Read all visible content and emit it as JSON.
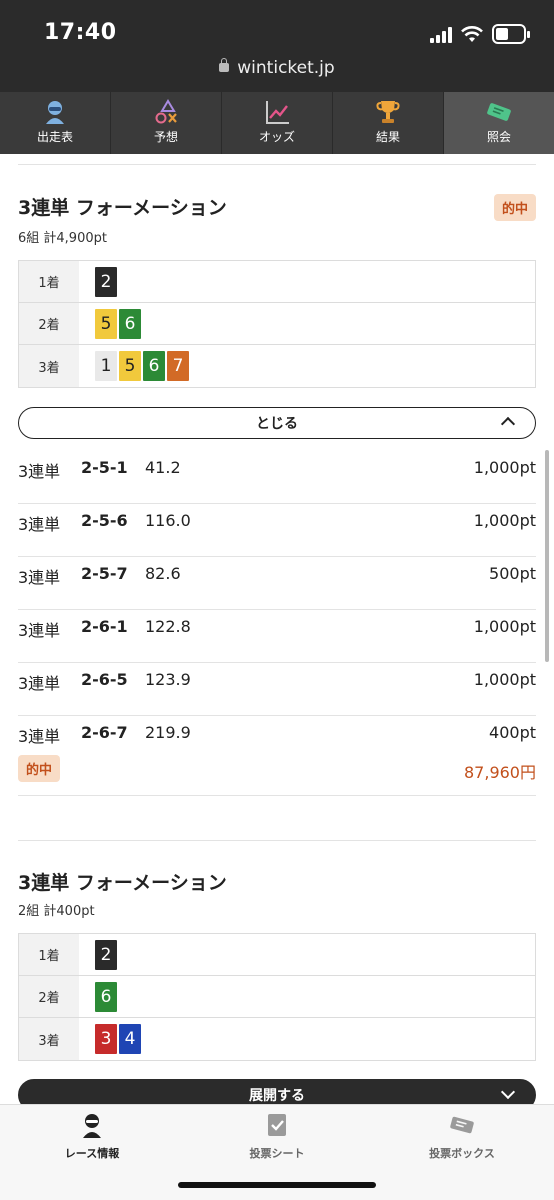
{
  "status": {
    "time": "17:40",
    "url": "winticket.jp"
  },
  "nav": {
    "tabs": [
      {
        "label": "出走表",
        "icon": "rider-icon"
      },
      {
        "label": "予想",
        "icon": "prediction-icon"
      },
      {
        "label": "オッズ",
        "icon": "odds-chart-icon"
      },
      {
        "label": "結果",
        "icon": "trophy-icon"
      },
      {
        "label": "照会",
        "icon": "ticket-icon"
      }
    ],
    "active_index": 4
  },
  "bet1": {
    "title": "3連単 フォーメーション",
    "summary": "6組 計4,900pt",
    "hit_label": "的中",
    "positions": [
      {
        "label": "1着",
        "numbers": [
          "2"
        ]
      },
      {
        "label": "2着",
        "numbers": [
          "5",
          "6"
        ]
      },
      {
        "label": "3着",
        "numbers": [
          "1",
          "5",
          "6",
          "7"
        ]
      }
    ],
    "toggle_label": "とじる",
    "rows": [
      {
        "type": "3連単",
        "combo": "2-5-1",
        "odds": "41.2",
        "amount": "1,000pt"
      },
      {
        "type": "3連単",
        "combo": "2-5-6",
        "odds": "116.0",
        "amount": "1,000pt"
      },
      {
        "type": "3連単",
        "combo": "2-5-7",
        "odds": "82.6",
        "amount": "500pt"
      },
      {
        "type": "3連単",
        "combo": "2-6-1",
        "odds": "122.8",
        "amount": "1,000pt"
      },
      {
        "type": "3連単",
        "combo": "2-6-5",
        "odds": "123.9",
        "amount": "1,000pt"
      },
      {
        "type": "3連単",
        "combo": "2-6-7",
        "odds": "219.9",
        "amount": "400pt"
      }
    ],
    "payout_hit_label": "的中",
    "payout": "87,960円"
  },
  "bet2": {
    "title": "3連単 フォーメーション",
    "summary": "2組 計400pt",
    "positions": [
      {
        "label": "1着",
        "numbers": [
          "2"
        ]
      },
      {
        "label": "2着",
        "numbers": [
          "6"
        ]
      },
      {
        "label": "3着",
        "numbers": [
          "3",
          "4"
        ]
      }
    ],
    "toggle_label": "展開する"
  },
  "bottom_nav": {
    "tabs": [
      {
        "label": "レース情報",
        "icon": "race-info-icon"
      },
      {
        "label": "投票シート",
        "icon": "bet-sheet-icon"
      },
      {
        "label": "投票ボックス",
        "icon": "bet-box-icon"
      }
    ]
  },
  "colors": {
    "num_1": "#e9e9e9",
    "num_2": "#2a2a2a",
    "num_3": "#c62b2b",
    "num_4": "#1f45b4",
    "num_5": "#f1c93c",
    "num_6": "#2c8a36",
    "num_7": "#d26a26",
    "hit_badge_bg": "#f8dcc6",
    "hit_text": "#c2501c"
  }
}
